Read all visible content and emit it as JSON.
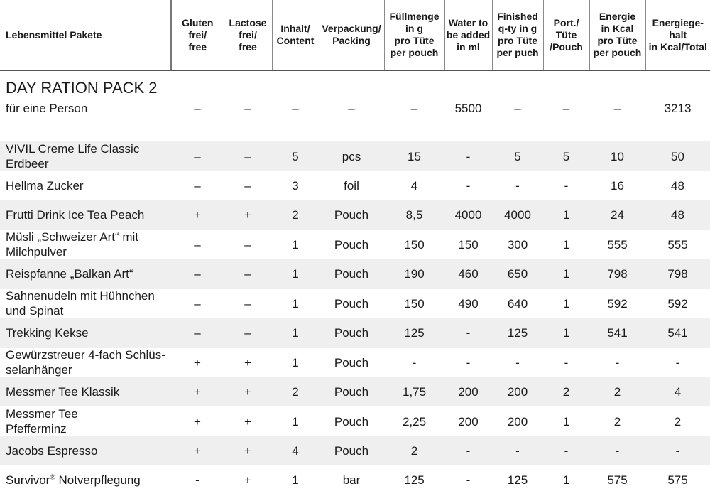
{
  "header": {
    "col0": "Lebensmittel Pakete",
    "col1": "Gluten\nfrei/\nfree",
    "col2": "Lactose\nfrei/\nfree",
    "col3": "Inhalt/\nContent",
    "col4": "Verpackung/\nPacking",
    "col5": "Füllmenge\nin g\npro Tüte\nper pouch",
    "col6": "Water to\nbe added\nin ml",
    "col7": "Finished\nq-ty in g\npro Tüte\nper puch",
    "col8": "Port./\nTüte\n/Pouch",
    "col9": "Energie\nin Kcal\npro Tüte\nper pouch",
    "col10": "Energiege-\nhalt\nin Kcal/Total"
  },
  "pack": {
    "title": "DAY RATION PACK 2",
    "subtitle": "für eine Person",
    "values": [
      "–",
      "–",
      "–",
      "–",
      "–",
      "5500",
      "–",
      "–",
      "–",
      "3213"
    ]
  },
  "items": [
    {
      "name": "VIVIL Creme Life Classic\nErdbeer",
      "gluten": "–",
      "lactose": "–",
      "content": "5",
      "packing": "pcs",
      "fill": "15",
      "water": "-",
      "finished": "5",
      "port": "5",
      "energy": "10",
      "total": "50"
    },
    {
      "name": "Hellma Zucker",
      "gluten": "–",
      "lactose": "–",
      "content": "3",
      "packing": "foil",
      "fill": "4",
      "water": "-",
      "finished": "-",
      "port": "-",
      "energy": "16",
      "total": "48"
    },
    {
      "name": "Frutti Drink Ice Tea Peach",
      "gluten": "+",
      "lactose": "+",
      "content": "2",
      "packing": "Pouch",
      "fill": "8,5",
      "water": "4000",
      "finished": "4000",
      "port": "1",
      "energy": "24",
      "total": "48"
    },
    {
      "name": "Müsli „Schweizer Art“ mit\nMilchpulver",
      "gluten": "–",
      "lactose": "–",
      "content": "1",
      "packing": "Pouch",
      "fill": "150",
      "water": "150",
      "finished": "300",
      "port": "1",
      "energy": "555",
      "total": "555"
    },
    {
      "name": "Reispfanne „Balkan Art“",
      "gluten": "–",
      "lactose": "–",
      "content": "1",
      "packing": "Pouch",
      "fill": "190",
      "water": "460",
      "finished": "650",
      "port": "1",
      "energy": "798",
      "total": "798"
    },
    {
      "name": "Sahnenudeln mit Hühnchen\nund Spinat",
      "gluten": "–",
      "lactose": "–",
      "content": "1",
      "packing": "Pouch",
      "fill": "150",
      "water": "490",
      "finished": "640",
      "port": "1",
      "energy": "592",
      "total": "592"
    },
    {
      "name": "Trekking Kekse",
      "gluten": "–",
      "lactose": "–",
      "content": "1",
      "packing": "Pouch",
      "fill": "125",
      "water": "-",
      "finished": "125",
      "port": "1",
      "energy": "541",
      "total": "541"
    },
    {
      "name": "Gewürzstreuer 4-fach Schlüs-\nselanhänger",
      "gluten": "+",
      "lactose": "+",
      "content": "1",
      "packing": "Pouch",
      "fill": "-",
      "water": "-",
      "finished": "-",
      "port": "-",
      "energy": "-",
      "total": "-"
    },
    {
      "name": "Messmer Tee Klassik",
      "gluten": "+",
      "lactose": "+",
      "content": "2",
      "packing": "Pouch",
      "fill": "1,75",
      "water": "200",
      "finished": "200",
      "port": "2",
      "energy": "2",
      "total": "4"
    },
    {
      "name": "Messmer Tee\nPfefferminz",
      "gluten": "+",
      "lactose": "+",
      "content": "1",
      "packing": "Pouch",
      "fill": "2,25",
      "water": "200",
      "finished": "200",
      "port": "1",
      "energy": "2",
      "total": "2"
    },
    {
      "name": "Jacobs Espresso",
      "gluten": "+",
      "lactose": "+",
      "content": "4",
      "packing": "Pouch",
      "fill": "2",
      "water": "-",
      "finished": "-",
      "port": "-",
      "energy": "-",
      "total": "-"
    },
    {
      "name": "Survivor",
      "name_sup": "®",
      "name_suffix": " Notverpflegung",
      "gluten": "-",
      "lactose": "+",
      "content": "1",
      "packing": "bar",
      "fill": "125",
      "water": "-",
      "finished": "125",
      "port": "1",
      "energy": "575",
      "total": "575"
    }
  ]
}
